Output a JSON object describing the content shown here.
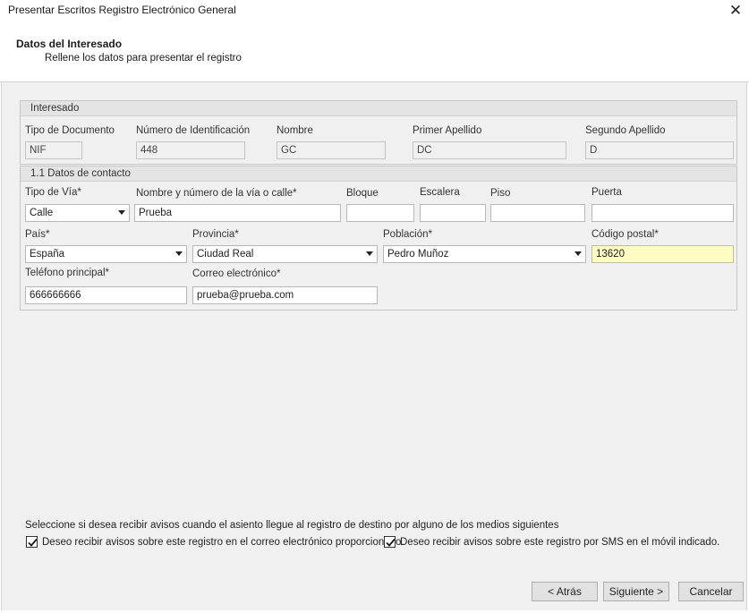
{
  "window": {
    "title": "Presentar Escritos Registro Electrónico General",
    "close_glyph": "✕"
  },
  "header": {
    "title": "Datos del Interesado",
    "subtitle": "Rellene los datos para presentar el registro"
  },
  "interesado": {
    "group_title": "Interesado",
    "tipo_documento": {
      "label": "Tipo de Documento",
      "value": "NIF"
    },
    "numero_identificacion": {
      "label": "Número de Identificación",
      "value": "448"
    },
    "nombre": {
      "label": "Nombre",
      "value": "GC"
    },
    "primer_apellido": {
      "label": "Primer Apellido",
      "value": "DC"
    },
    "segundo_apellido": {
      "label": "Segundo Apellido",
      "value": "D"
    }
  },
  "contacto": {
    "group_title": "1.1 Datos de contacto",
    "tipo_via": {
      "label": "Tipo de Vía*",
      "value": "Calle"
    },
    "nombre_via": {
      "label": "Nombre y número de la vía o calle*",
      "value": "Prueba"
    },
    "bloque": {
      "label": "Bloque",
      "value": ""
    },
    "escalera": {
      "label": "Escalera",
      "value": ""
    },
    "piso": {
      "label": "Piso",
      "value": ""
    },
    "puerta": {
      "label": "Puerta",
      "value": ""
    },
    "pais": {
      "label": "País*",
      "value": "España"
    },
    "provincia": {
      "label": "Provincia*",
      "value": "Ciudad Real"
    },
    "poblacion": {
      "label": "Población*",
      "value": "Pedro Muñoz"
    },
    "codigo_postal": {
      "label": "Código postal*",
      "value": "13620"
    },
    "telefono": {
      "label": "Teléfono principal*",
      "value": "666666666"
    },
    "correo": {
      "label": "Correo electrónico*",
      "value": "prueba@prueba.com"
    }
  },
  "avisos": {
    "intro": "Seleccione si desea recibir avisos cuando el asiento llegue al registro de destino por alguno de los medios siguientes",
    "email_label": "Deseo recibir avisos sobre este registro en el correo electrónico proporcionado.",
    "email_checked": true,
    "sms_label": "Deseo recibir avisos sobre este registro por SMS en el móvil indicado.",
    "sms_checked": true
  },
  "buttons": {
    "back": "< Atrás",
    "next": "Siguiente >",
    "cancel": "Cancelar"
  },
  "colors": {
    "highlight_field": "#fefbc3",
    "panel_bg": "#f0f0f0",
    "group_header_bg": "#e4e4e4"
  }
}
